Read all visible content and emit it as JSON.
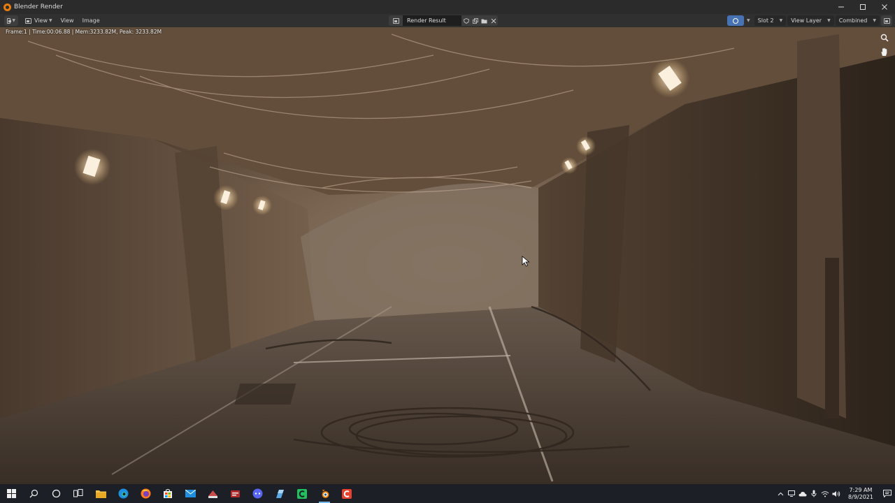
{
  "window": {
    "title": "Blender Render",
    "controls": [
      "minimize",
      "maximize",
      "close"
    ]
  },
  "header": {
    "menu": [
      {
        "label": "View"
      },
      {
        "label": "View"
      },
      {
        "label": "Image"
      }
    ],
    "image_name": "Render Result",
    "slot": "Slot 2",
    "view_layer": "View Layer",
    "pass": "Combined"
  },
  "viewport": {
    "stats": "Frame:1 | Time:00:06.88 | Mem:3233.82M, Peak: 3233.82M"
  },
  "taskbar": {
    "apps": [
      {
        "name": "start-icon"
      },
      {
        "name": "search-icon"
      },
      {
        "name": "cortana-icon"
      },
      {
        "name": "task-view-icon"
      },
      {
        "name": "file-explorer-icon"
      },
      {
        "name": "edge-icon"
      },
      {
        "name": "firefox-icon"
      },
      {
        "name": "store-icon"
      },
      {
        "name": "mail-icon"
      },
      {
        "name": "app-icon-1"
      },
      {
        "name": "app-icon-2"
      },
      {
        "name": "app-icon-3"
      },
      {
        "name": "app-icon-4"
      },
      {
        "name": "app-icon-5"
      },
      {
        "name": "blender-icon"
      },
      {
        "name": "app-icon-6"
      }
    ],
    "time": "7:29 AM",
    "date": "8/9/2021"
  },
  "colors": {
    "titlebar": "#2b2b2b",
    "header": "#303030",
    "accent": "#4772b3",
    "blender_orange": "#e87d0d",
    "taskbar": "#1c1f26"
  }
}
